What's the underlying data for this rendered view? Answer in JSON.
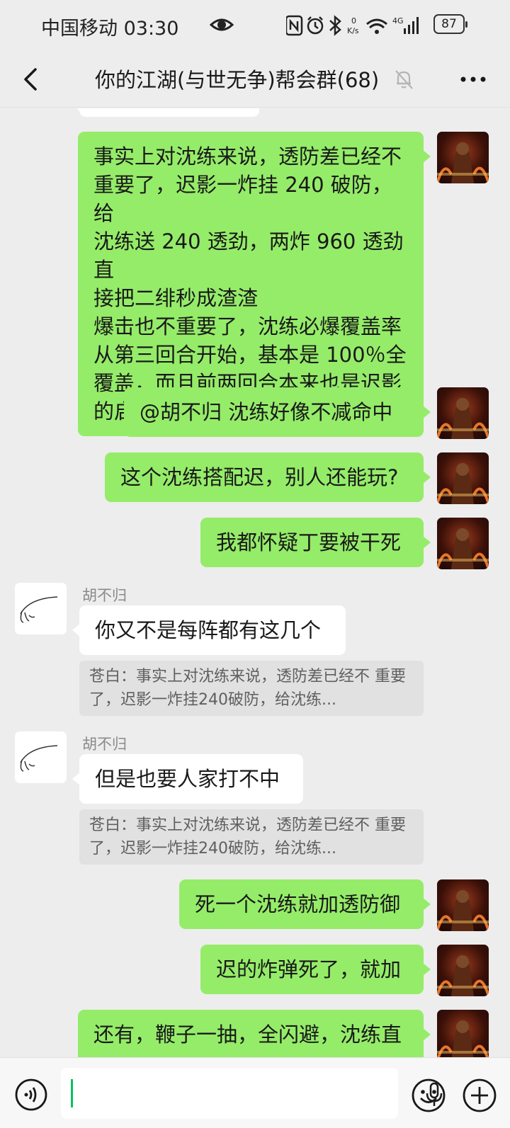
{
  "status_bar": {
    "carrier_time": "中国移动 03:30",
    "net_speed_top": "0",
    "net_speed_unit": "K/s",
    "signal_type": "4G",
    "battery": "87"
  },
  "header": {
    "title": "你的江湖(与世无争)帮会群(68)",
    "back_icon": "chevron-left-icon",
    "mute_icon": "bell-muted-icon",
    "more_icon": "more-dots-icon"
  },
  "messages": [
    {
      "side": "me",
      "text": "事实上对沈练来说，透防差已经不\n重要了，迟影一炸挂 240 破防，给\n沈练送 240 透劲，两炸 960 透劲直\n接把二绯秒成渣渣\n爆击也不重要了，沈练必爆覆盖率\n从第三回合开始，基本是 100％全\n覆盖，而且前两回合本来也是迟影\n的启动轴，放了就放了"
    },
    {
      "side": "me",
      "text": "@胡不归  沈练好像不减命中"
    },
    {
      "side": "me",
      "text": "这个沈练搭配迟，别人还能玩?"
    },
    {
      "side": "me",
      "text": "我都怀疑丁要被干死"
    },
    {
      "side": "other",
      "sender": "胡不归",
      "text": "你又不是每阵都有这几个",
      "quote": "苍白：事实上对沈练来说，透防差已经不\n重要了，迟影一炸挂240破防，给沈练..."
    },
    {
      "side": "other",
      "sender": "胡不归",
      "text": "但是也要人家打不中",
      "quote": "苍白：事实上对沈练来说，透防差已经不\n重要了，迟影一炸挂240破防，给沈练..."
    },
    {
      "side": "me",
      "text": "死一个沈练就加透防御"
    },
    {
      "side": "me",
      "text": "迟的炸弹死了，就加"
    },
    {
      "side": "me",
      "text": "还有，鞭子一抽，全闪避，沈练直"
    }
  ],
  "input_bar": {
    "voice_icon": "voice-icon",
    "mic_icon": "microphone-icon",
    "emoji_icon": "emoji-icon",
    "plus_icon": "plus-icon"
  }
}
